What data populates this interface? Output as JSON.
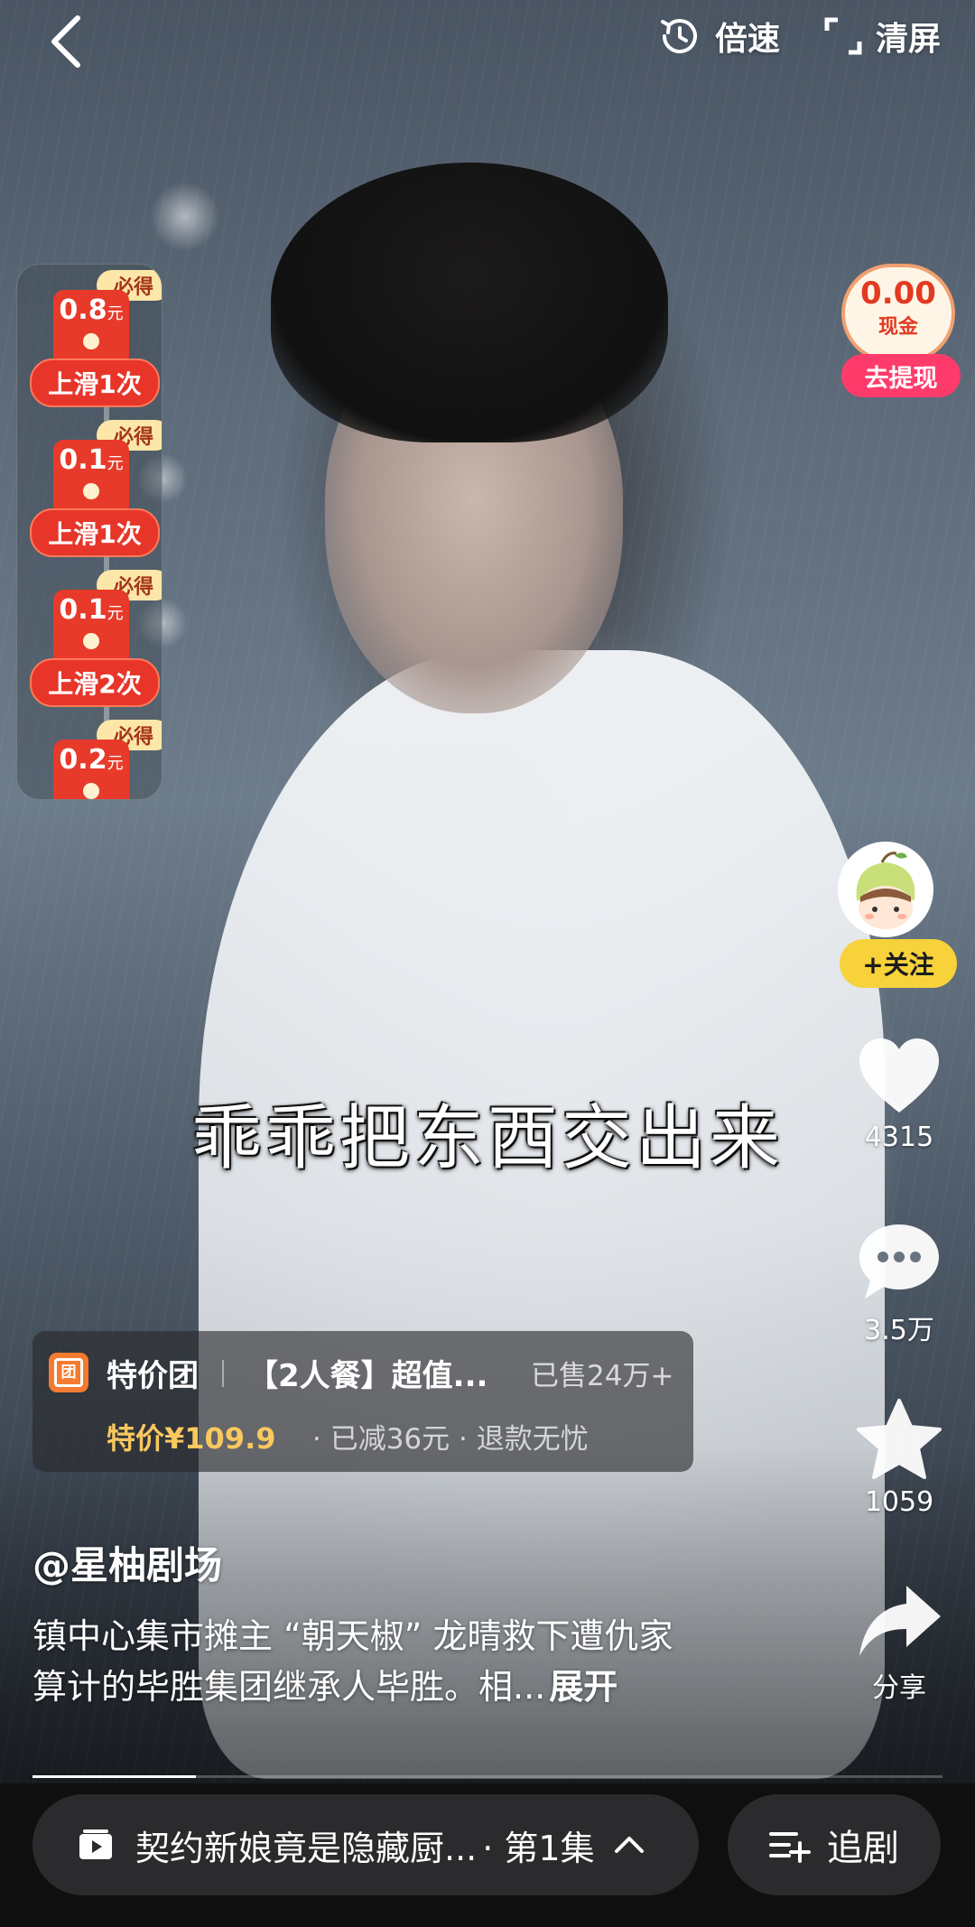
{
  "topbar": {
    "speed_label": "倍速",
    "clear_label": "清屏"
  },
  "rewards": [
    {
      "badge": "必得",
      "amount": "0.8",
      "unit": "元",
      "action": "上滑1次"
    },
    {
      "badge": "必得",
      "amount": "0.1",
      "unit": "元",
      "action": "上滑1次"
    },
    {
      "badge": "必得",
      "amount": "0.1",
      "unit": "元",
      "action": "上滑2次"
    },
    {
      "badge": "必得",
      "amount": "0.2",
      "unit": "元",
      "action": ""
    }
  ],
  "cash": {
    "value": "0.00",
    "unit": "现金",
    "withdraw_label": "去提现"
  },
  "side_actions": {
    "follow_label": "+关注",
    "like_count": "4315",
    "comment_count": "3.5万",
    "favorite_count": "1059",
    "share_label": "分享"
  },
  "subtitle": "乖乖把东西交出来",
  "product": {
    "shop": "特价团",
    "name": "【2人餐】超值...",
    "sold": "已售24万+",
    "price": "特价¥109.9",
    "extra": "· 已减36元 · 退款无忧"
  },
  "author": "@星柚剧场",
  "description": {
    "line1": "镇中心集市摊主 “朝天椒” 龙晴救下遭仇家",
    "line2": "算计的毕胜集团继承人毕胜。相...",
    "more": "展开"
  },
  "progress": 0.18,
  "bottom": {
    "title": "契约新娘竟是隐藏厨...",
    "episode": "· 第1集",
    "follow_drama_label": "追剧"
  },
  "colors": {
    "accent_red": "#e8352a",
    "follow_yellow": "#f7d23b",
    "price_gold": "#f9c85e",
    "withdraw_pink": "#ff3b6b"
  }
}
